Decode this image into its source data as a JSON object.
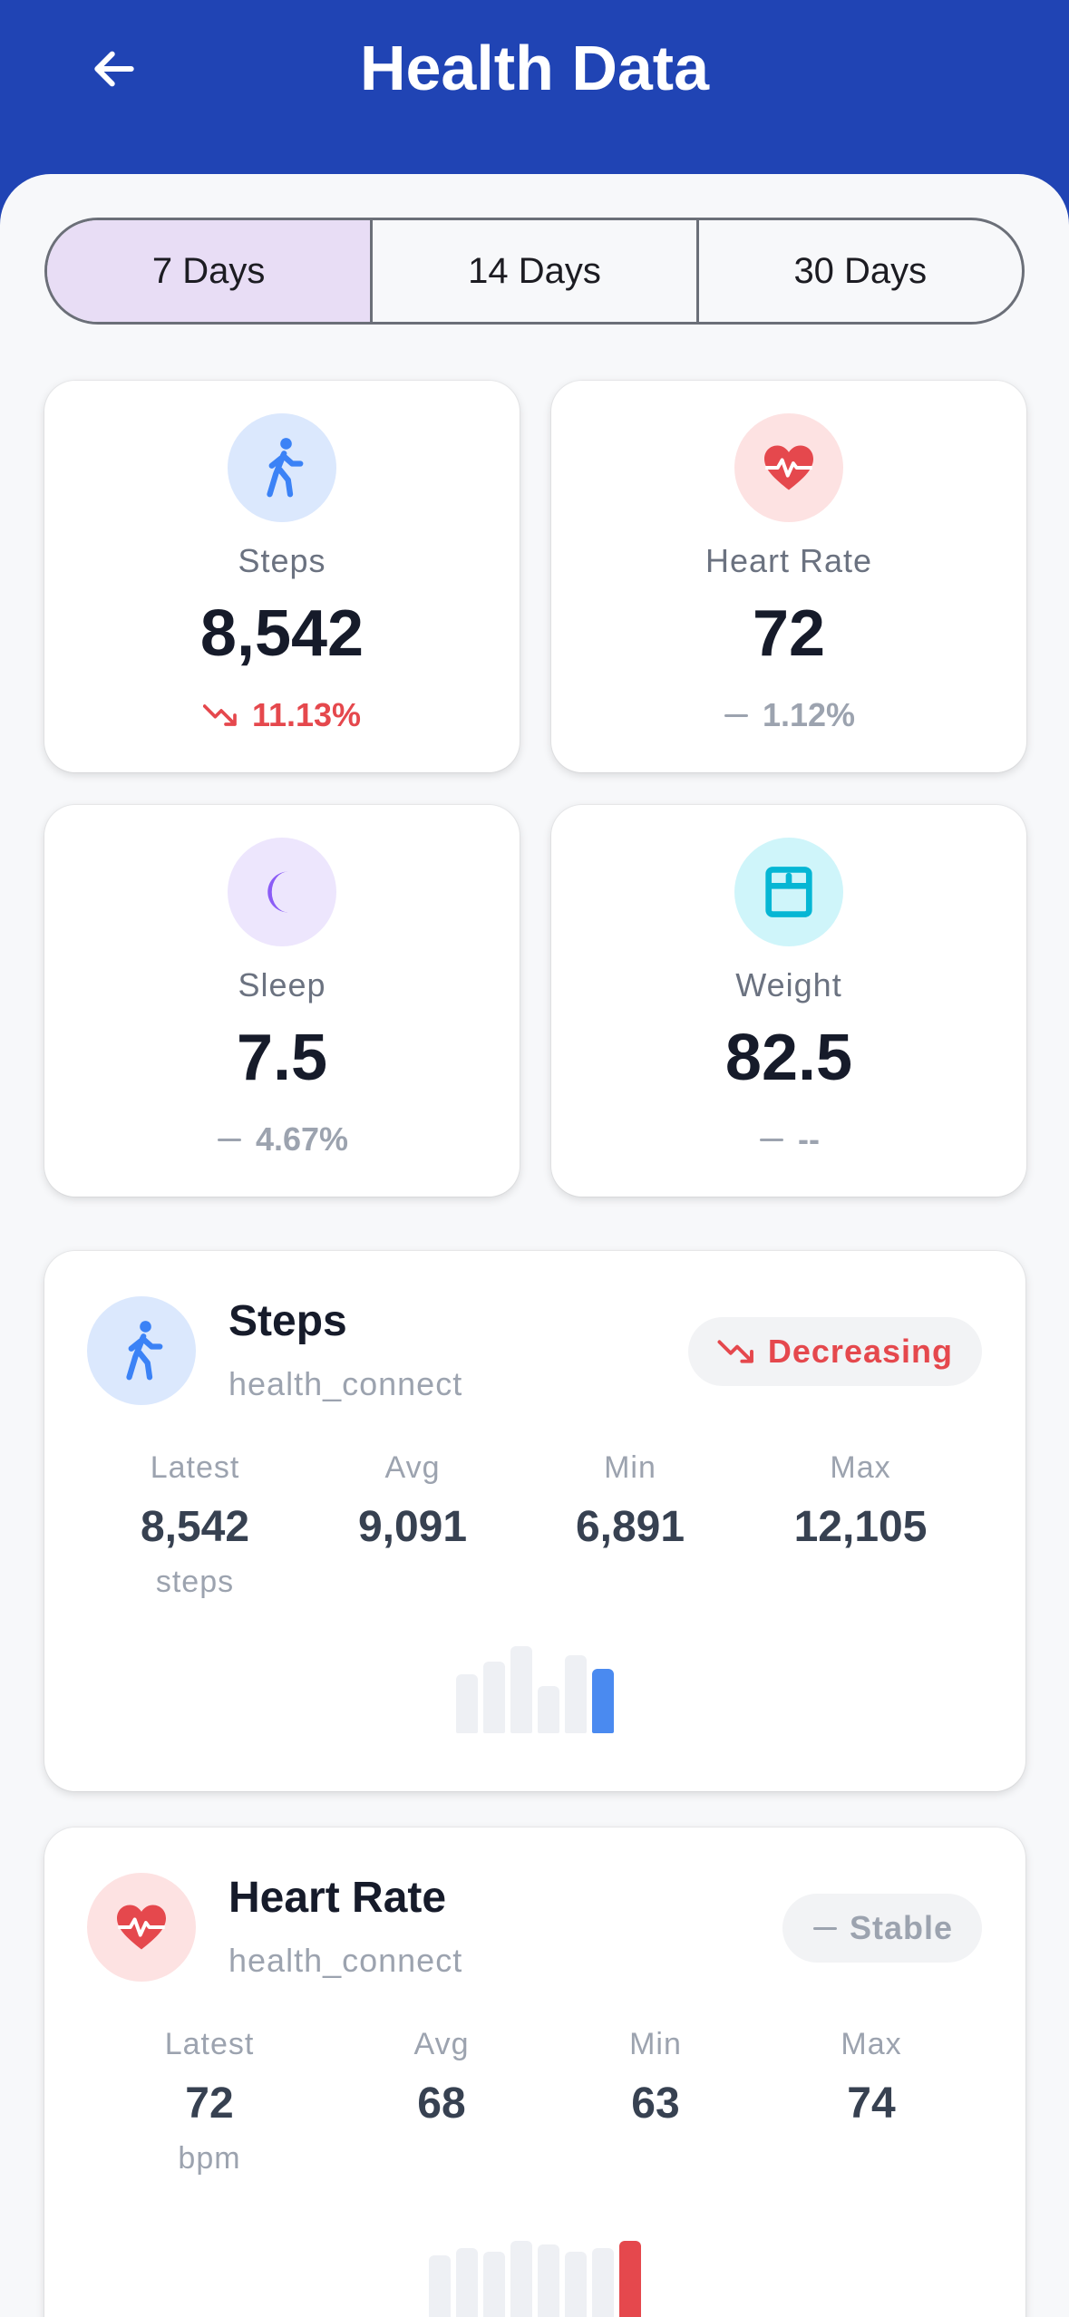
{
  "header": {
    "title": "Health Data",
    "back_icon": "arrow-left-icon"
  },
  "tabs": [
    {
      "label": "7 Days",
      "active": true
    },
    {
      "label": "14 Days",
      "active": false
    },
    {
      "label": "30 Days",
      "active": false
    }
  ],
  "stats": [
    {
      "label": "Steps",
      "value": "8,542",
      "change": "11.13%",
      "trend": "down",
      "icon": "walk-icon",
      "icon_color": "#3b82f6",
      "icon_bg": "#dbe8fd"
    },
    {
      "label": "Heart Rate",
      "value": "72",
      "change": "1.12%",
      "trend": "flat",
      "icon": "heart-pulse-icon",
      "icon_color": "#e5484d",
      "icon_bg": "#fde2e2"
    },
    {
      "label": "Sleep",
      "value": "7.5",
      "change": "4.67%",
      "trend": "flat",
      "icon": "moon-icon",
      "icon_color": "#8b5cf6",
      "icon_bg": "#ede6fd"
    },
    {
      "label": "Weight",
      "value": "82.5",
      "change": "--",
      "trend": "flat",
      "icon": "scale-icon",
      "icon_color": "#06b6d4",
      "icon_bg": "#cff5fa"
    }
  ],
  "details": [
    {
      "title": "Steps",
      "source": "health_connect",
      "trend_label": "Decreasing",
      "trend": "down",
      "icon": "walk-icon",
      "metrics": [
        {
          "label": "Latest",
          "value": "8,542",
          "unit": "steps"
        },
        {
          "label": "Avg",
          "value": "9,091"
        },
        {
          "label": "Min",
          "value": "6,891"
        },
        {
          "label": "Max",
          "value": "12,105"
        }
      ],
      "chart_values": [
        6891,
        8100,
        9600,
        5800,
        8700,
        7400
      ],
      "highlight_color": "#4a8af0"
    },
    {
      "title": "Heart Rate",
      "source": "health_connect",
      "trend_label": "Stable",
      "trend": "flat",
      "icon": "heart-pulse-icon",
      "metrics": [
        {
          "label": "Latest",
          "value": "72",
          "unit": "bpm"
        },
        {
          "label": "Avg",
          "value": "68"
        },
        {
          "label": "Min",
          "value": "63"
        },
        {
          "label": "Max",
          "value": "74"
        }
      ],
      "chart_values": [
        68,
        70,
        69,
        72,
        71,
        69,
        70,
        72
      ],
      "highlight_color": "#e5484d"
    }
  ]
}
